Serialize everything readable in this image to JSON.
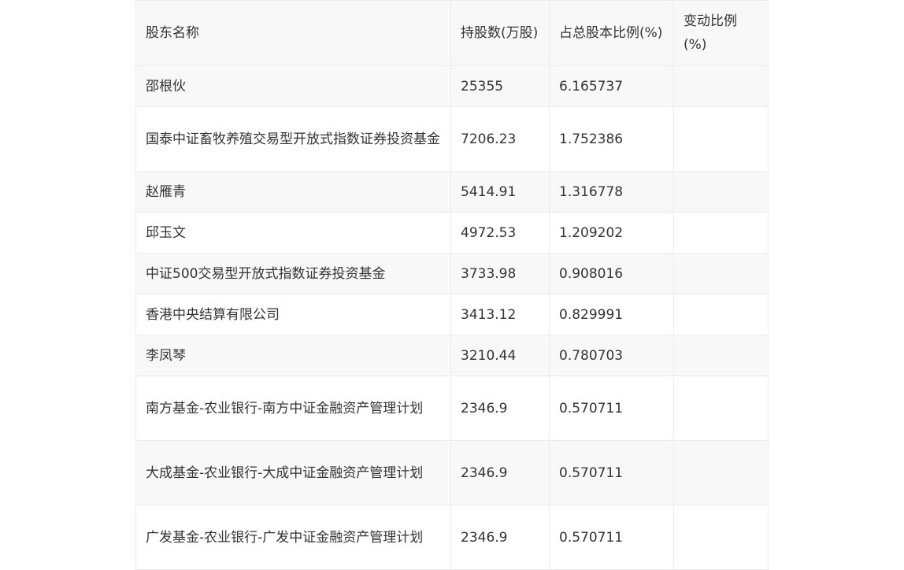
{
  "table": {
    "headers": [
      "股东名称",
      "持股数(万股)",
      "占总股本比例(%)",
      "变动比例(%)"
    ],
    "rows": [
      {
        "name": "邵根伙",
        "shares": "25355",
        "ratio": "6.165737",
        "change": ""
      },
      {
        "name": "国泰中证畜牧养殖交易型开放式指数证券投资基金",
        "shares": "7206.23",
        "ratio": "1.752386",
        "change": ""
      },
      {
        "name": "赵雁青",
        "shares": "5414.91",
        "ratio": "1.316778",
        "change": ""
      },
      {
        "name": "邱玉文",
        "shares": "4972.53",
        "ratio": "1.209202",
        "change": ""
      },
      {
        "name": "中证500交易型开放式指数证券投资基金",
        "shares": "3733.98",
        "ratio": "0.908016",
        "change": ""
      },
      {
        "name": "香港中央结算有限公司",
        "shares": "3413.12",
        "ratio": "0.829991",
        "change": ""
      },
      {
        "name": "李凤琴",
        "shares": "3210.44",
        "ratio": "0.780703",
        "change": ""
      },
      {
        "name": "南方基金-农业银行-南方中证金融资产管理计划",
        "shares": "2346.9",
        "ratio": "0.570711",
        "change": ""
      },
      {
        "name": "大成基金-农业银行-大成中证金融资产管理计划",
        "shares": "2346.9",
        "ratio": "0.570711",
        "change": ""
      },
      {
        "name": "广发基金-农业银行-广发中证金融资产管理计划",
        "shares": "2346.9",
        "ratio": "0.570711",
        "change": ""
      }
    ]
  }
}
